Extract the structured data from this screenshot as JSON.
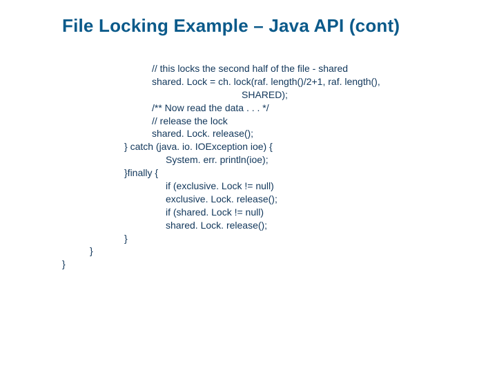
{
  "title": "File Locking Example – Java API (cont)",
  "code": {
    "lines": [
      {
        "indent": 3,
        "text": "// this locks the second half of the file - shared"
      },
      {
        "indent": 3,
        "text": "shared. Lock = ch. lock(raf. length()/2+1, raf. length(),"
      },
      {
        "indent": 5,
        "text": "SHARED);"
      },
      {
        "indent": 3,
        "text": "/** Now read the data . . . */"
      },
      {
        "indent": 3,
        "text": "// release the lock"
      },
      {
        "indent": 3,
        "text": "shared. Lock. release();"
      },
      {
        "indent": 2,
        "text": "} catch (java. io. IOException ioe) {"
      },
      {
        "indent": 4,
        "text": "System. err. println(ioe);"
      },
      {
        "indent": 2,
        "text": "}finally {"
      },
      {
        "indent": 4,
        "text": "if (exclusive. Lock != null)"
      },
      {
        "indent": 4,
        "text": "exclusive. Lock. release();"
      },
      {
        "indent": 4,
        "text": "if (shared. Lock != null)"
      },
      {
        "indent": 4,
        "text": "shared. Lock. release();"
      },
      {
        "indent": 2,
        "text": "}"
      },
      {
        "indent": 1,
        "text": "}"
      },
      {
        "indent": 0,
        "text": "}"
      }
    ]
  }
}
